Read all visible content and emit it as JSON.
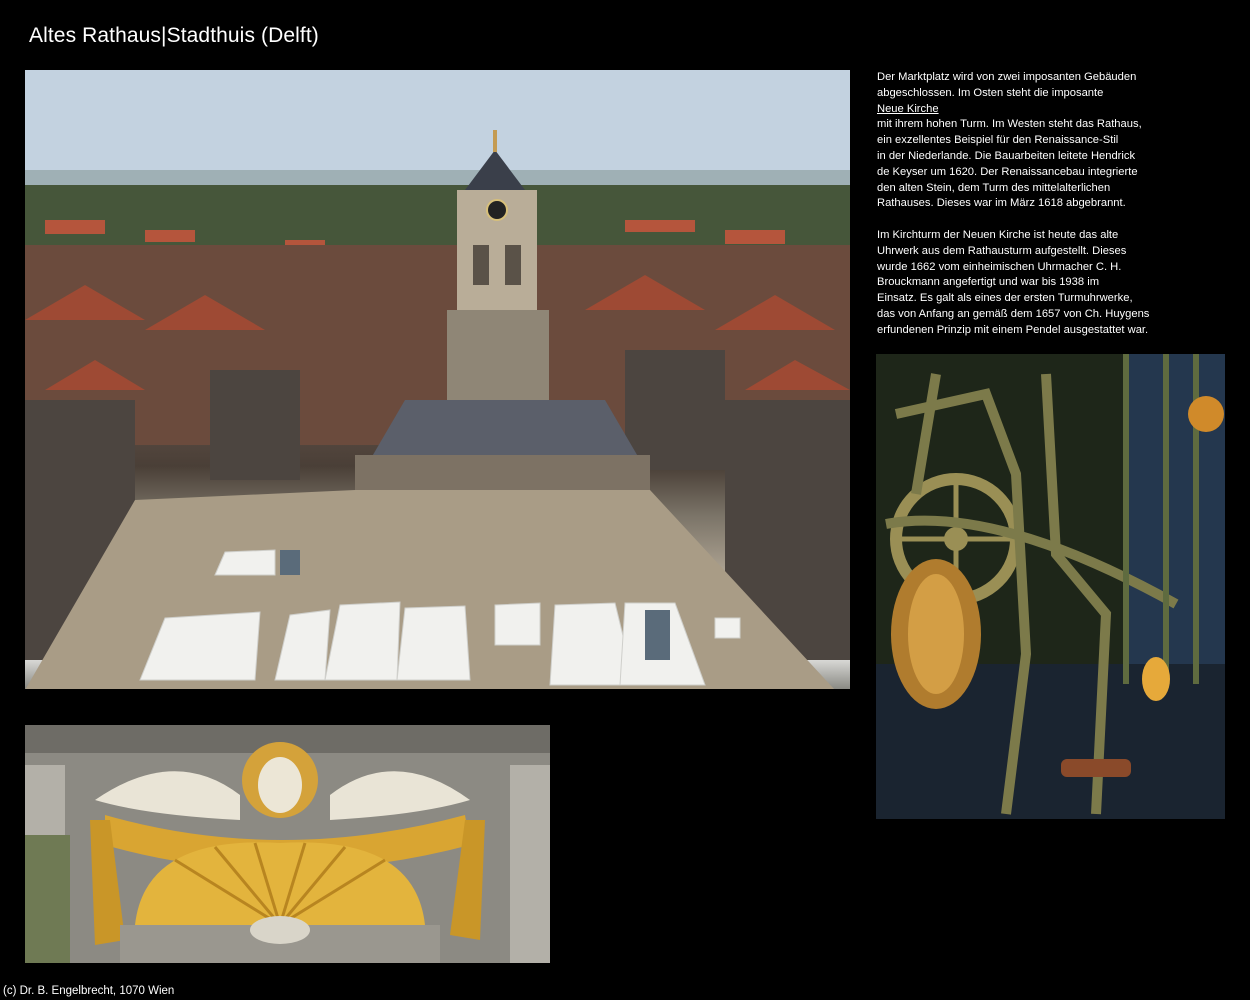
{
  "page": {
    "title": "Altes Rathaus|Stadthuis (Delft)",
    "footer": "(c) Dr. B. Engelbrecht, 1070 Wien"
  },
  "description": {
    "paragraph1": {
      "lines_before_link": [
        "Der Marktplatz wird von zwei imposanten Gebäuden",
        "abgeschlossen. Im Osten steht die imposante"
      ],
      "link_text": "Neue Kirche",
      "lines_after_link": [
        "mit ihrem hohen Turm. Im Westen steht das Rathaus,",
        "ein exzellentes Beispiel für den Renaissance-Stil",
        "in der Niederlande. Die Bauarbeiten leitete Hendrick",
        "de Keyser um 1620. Der Renaissancebau integrierte",
        "den alten Stein, dem Turm des mittelalterlichen",
        "Rathauses. Dieses war im März 1618 abgebrannt."
      ]
    },
    "paragraph2": {
      "lines": [
        "Im Kirchturm der Neuen Kirche ist heute das alte",
        "Uhrwerk aus dem Rathausturm aufgestellt. Dieses",
        "wurde 1662 vom einheimischen Uhrmacher C. H.",
        "Brouckmann angefertigt und war bis 1938 im",
        "Einsatz. Es galt als eines der ersten Turmuhrwerke,",
        "das von Anfang an gemäß dem 1657 von Ch. Huygens",
        "erfundenen Prinzip mit einem Pendel ausgestattet war."
      ]
    }
  },
  "colors": {
    "background": "#000000",
    "text": "#ffffff"
  },
  "images": {
    "market": "photo-aerial-market-square-town-hall",
    "clock": "photo-clockwork-mechanism",
    "ornament": "photo-gilded-angel-shell-ornament"
  }
}
